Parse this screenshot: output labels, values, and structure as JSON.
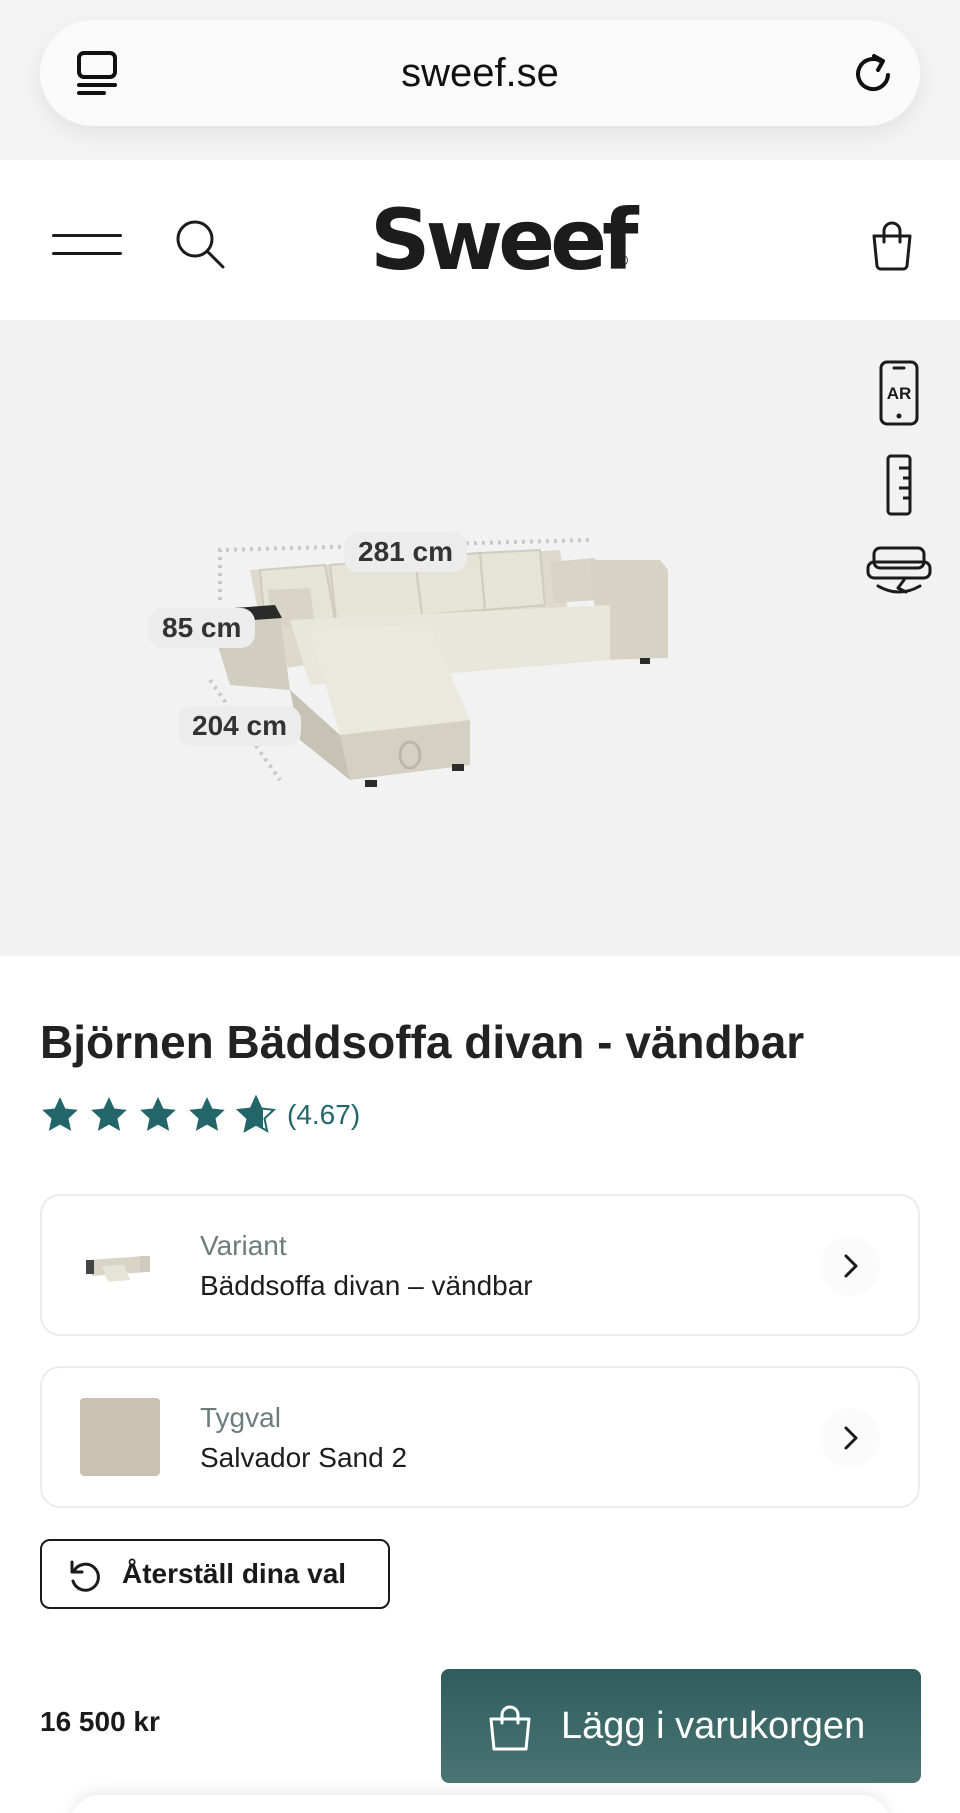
{
  "browser": {
    "url": "sweef.se"
  },
  "header": {
    "logo_text": "Sweef",
    "logo_mark": "®"
  },
  "product": {
    "title": "Björnen Bäddsoffa divan - vändbar",
    "rating": 4.67,
    "rating_label": "(4.67)",
    "dimensions": {
      "width": "281 cm",
      "height": "85 cm",
      "depth": "204 cm"
    },
    "side_tools": [
      "ar-icon",
      "measure-icon",
      "sofa-rotate-icon"
    ]
  },
  "options": [
    {
      "label": "Variant",
      "value": "Bäddsoffa divan – vändbar",
      "thumb": "sofa-thumbnail"
    },
    {
      "label": "Tygval",
      "value": "Salvador Sand 2",
      "thumb": "fabric-swatch",
      "swatch_color": "#c9c2b3"
    }
  ],
  "reset_button": "Återställ dina val",
  "price": "16 500 kr",
  "add_to_cart": "Lägg i varukorgen",
  "colors": {
    "accent": "#23666a",
    "button": "#2e5d5d",
    "sofa": "#e4e1d4"
  }
}
